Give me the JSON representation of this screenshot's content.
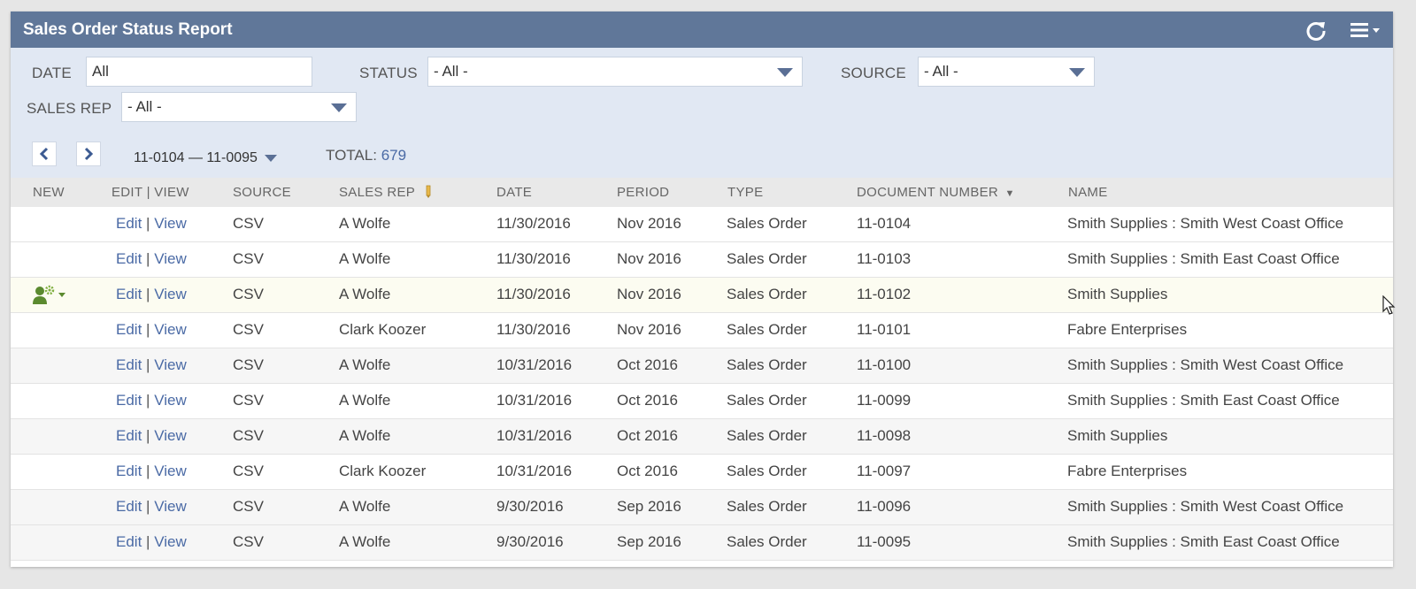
{
  "header": {
    "title": "Sales Order Status Report",
    "icons": [
      "refresh-icon",
      "menu-icon"
    ]
  },
  "filters": {
    "date_label": "DATE",
    "date_value": "All",
    "status_label": "STATUS",
    "status_value": "- All -",
    "source_label": "SOURCE",
    "source_value": "- All -",
    "salesrep_label": "SALES REP",
    "salesrep_value": "- All -"
  },
  "pager": {
    "range": "11-0104 — 11-0095",
    "total_label": "TOTAL:",
    "total_value": "679"
  },
  "columns": {
    "new": "NEW",
    "edit_view": "EDIT | VIEW",
    "source": "SOURCE",
    "sales_rep": "SALES REP",
    "date": "DATE",
    "period": "PERIOD",
    "type": "TYPE",
    "doc_number": "DOCUMENT NUMBER",
    "name": "NAME"
  },
  "row_links": {
    "edit": "Edit",
    "view": "View",
    "separator": "|"
  },
  "rows": [
    {
      "source": "CSV",
      "sales_rep": "A Wolfe",
      "date": "11/30/2016",
      "period": "Nov 2016",
      "type": "Sales Order",
      "doc": "11-0104",
      "name": "Smith Supplies : Smith West Coast Office"
    },
    {
      "source": "CSV",
      "sales_rep": "A Wolfe",
      "date": "11/30/2016",
      "period": "Nov 2016",
      "type": "Sales Order",
      "doc": "11-0103",
      "name": "Smith Supplies : Smith East Coast Office"
    },
    {
      "source": "CSV",
      "sales_rep": "A Wolfe",
      "date": "11/30/2016",
      "period": "Nov 2016",
      "type": "Sales Order",
      "doc": "11-0102",
      "name": "Smith Supplies"
    },
    {
      "source": "CSV",
      "sales_rep": "Clark Koozer",
      "date": "11/30/2016",
      "period": "Nov 2016",
      "type": "Sales Order",
      "doc": "11-0101",
      "name": "Fabre Enterprises"
    },
    {
      "source": "CSV",
      "sales_rep": "A Wolfe",
      "date": "10/31/2016",
      "period": "Oct 2016",
      "type": "Sales Order",
      "doc": "11-0100",
      "name": "Smith Supplies : Smith West Coast Office"
    },
    {
      "source": "CSV",
      "sales_rep": "A Wolfe",
      "date": "10/31/2016",
      "period": "Oct 2016",
      "type": "Sales Order",
      "doc": "11-0099",
      "name": "Smith Supplies : Smith East Coast Office"
    },
    {
      "source": "CSV",
      "sales_rep": "A Wolfe",
      "date": "10/31/2016",
      "period": "Oct 2016",
      "type": "Sales Order",
      "doc": "11-0098",
      "name": "Smith Supplies"
    },
    {
      "source": "CSV",
      "sales_rep": "Clark Koozer",
      "date": "10/31/2016",
      "period": "Oct 2016",
      "type": "Sales Order",
      "doc": "11-0097",
      "name": "Fabre Enterprises"
    },
    {
      "source": "CSV",
      "sales_rep": "A Wolfe",
      "date": "9/30/2016",
      "period": "Sep 2016",
      "type": "Sales Order",
      "doc": "11-0096",
      "name": "Smith Supplies : Smith West Coast Office"
    },
    {
      "source": "CSV",
      "sales_rep": "A Wolfe",
      "date": "9/30/2016",
      "period": "Sep 2016",
      "type": "Sales Order",
      "doc": "11-0095",
      "name": "Smith Supplies : Smith East Coast Office"
    }
  ],
  "colors": {
    "title_bar": "#607799",
    "filter_bg": "#e1e8f3",
    "link": "#4a6aa5",
    "action_icon": "#5b8a2f"
  }
}
